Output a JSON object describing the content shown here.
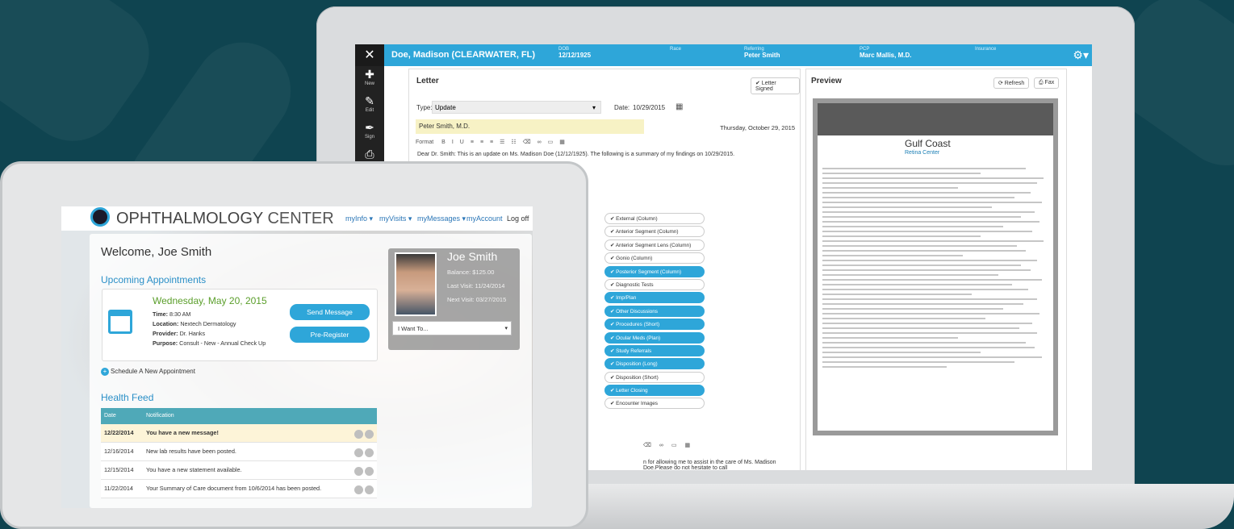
{
  "emr": {
    "patient_name": "Doe, Madison (CLEARWATER, FL)",
    "header_fields": [
      {
        "label": "DOB",
        "value": "12/12/1925"
      },
      {
        "label": "Race",
        "value": ""
      },
      {
        "label": "Referring",
        "value": "Peter Smith"
      },
      {
        "label": "PCP",
        "value": "Marc Mallis, M.D."
      },
      {
        "label": "Insurance",
        "value": ""
      }
    ],
    "left_nav": [
      {
        "icon": "plus-icon",
        "label": "New"
      },
      {
        "icon": "edit-icon",
        "label": "Edit"
      },
      {
        "icon": "pen-icon",
        "label": "Sign"
      },
      {
        "icon": "print-icon",
        "label": ""
      }
    ],
    "letter": {
      "title": "Letter",
      "signed_label": "✔ Letter Signed",
      "type_label": "Type:",
      "type_value": "Update",
      "date_label": "Date:",
      "date_value": "10/29/2015",
      "recipient": "Peter Smith, M.D.",
      "long_date": "Thursday, October 29, 2015",
      "format_label": "Format",
      "body": "Dear Dr. Smith: This is an update on Ms. Madison Doe (12/12/1925). The following is a summary of my findings on 10/29/2015.",
      "closing_fragment": "n for allowing me to assist in the care of Ms. Madison Doe.Please do not hesitate to call"
    },
    "sections": [
      {
        "label": "✔ External (Column)",
        "on": false
      },
      {
        "label": "✔ Anterior Segment (Column)",
        "on": false
      },
      {
        "label": "✔ Anterior Segment Lens (Column)",
        "on": false
      },
      {
        "label": "✔ Gonio (Column)",
        "on": false
      },
      {
        "label": "✔ Posterior Segment (Column)",
        "on": true
      },
      {
        "label": "✔ Diagnostic Tests",
        "on": false
      },
      {
        "label": "✔ Imp/Plan",
        "on": true
      },
      {
        "label": "✔ Other Discussions",
        "on": true
      },
      {
        "label": "✔ Procedures (Short)",
        "on": true
      },
      {
        "label": "✔ Ocular Meds (Plan)",
        "on": true
      },
      {
        "label": "✔ Study Referrals",
        "on": true
      },
      {
        "label": "✔ Disposition (Long)",
        "on": true
      },
      {
        "label": "✔ Disposition (Short)",
        "on": false
      },
      {
        "label": "✔ Letter Closing",
        "on": true
      },
      {
        "label": "✔ Encounter Images",
        "on": false
      }
    ],
    "preview": {
      "title": "Preview",
      "refresh_label": "⟳ Refresh",
      "fax_label": "Fax",
      "brand": "Gulf Coast",
      "brand_sub": "Retina Center"
    }
  },
  "portal": {
    "logo_bold": "OPHTHALMOLOGY",
    "logo_light": "CENTER",
    "nav": [
      {
        "label": "myInfo ▾"
      },
      {
        "label": "myVisits ▾"
      },
      {
        "label": "myMessages ▾"
      },
      {
        "label": "myAccount"
      },
      {
        "label": "Log off"
      }
    ],
    "welcome": "Welcome, Joe Smith",
    "upcoming_title": "Upcoming Appointments",
    "appointment": {
      "date": "Wednesday, May 20, 2015",
      "time_label": "Time:",
      "time": "8:30 AM",
      "location_label": "Location:",
      "location": "Nextech Dermatology",
      "provider_label": "Provider:",
      "provider": "Dr. Hanks",
      "purpose_label": "Purpose:",
      "purpose": "Consult - New - Annual Check Up"
    },
    "send_message": "Send Message",
    "pre_register": "Pre-Register",
    "profile": {
      "name": "Joe Smith",
      "balance": "Balance: $125.00",
      "last_visit": "Last Visit: 11/24/2014",
      "next_visit": "Next Visit: 03/27/2015"
    },
    "want_to": "I Want To...",
    "schedule_label": "Schedule A New Appointment",
    "health_feed_title": "Health Feed",
    "feed_headers": {
      "date": "Date",
      "notification": "Notification"
    },
    "feed": [
      {
        "date": "12/22/2014",
        "text": "You have a new message!",
        "highlight": true
      },
      {
        "date": "12/16/2014",
        "text": "New lab results have been posted.",
        "highlight": false
      },
      {
        "date": "12/15/2014",
        "text": "You have a new statement available.",
        "highlight": false
      },
      {
        "date": "11/22/2014",
        "text": "Your Summary of Care document from 10/6/2014 has been posted.",
        "highlight": false
      }
    ]
  }
}
